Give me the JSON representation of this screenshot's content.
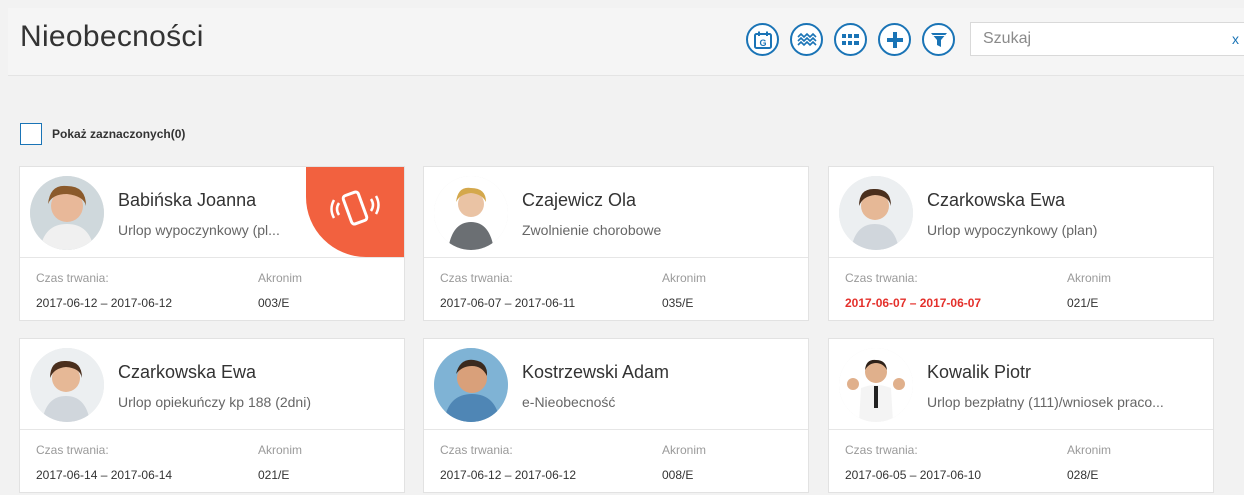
{
  "header": {
    "title": "Nieobecności",
    "search_placeholder": "Szukaj",
    "clear_label": "x"
  },
  "toolbar": {
    "icons": [
      "calendar-icon",
      "wave-chart-icon",
      "list-view-icon",
      "add-icon",
      "filter-icon"
    ],
    "accent_color": "#1a74b6",
    "calendar_badge": "G"
  },
  "filter": {
    "show_selected_label": "Pokaż zaznaczonych(0)"
  },
  "labels": {
    "duration": "Czas trwania:",
    "acronym": "Akronim"
  },
  "cards": [
    {
      "name": "Babińska Joanna",
      "reason": "Urlop wypoczynkowy (pl...",
      "dates": "2017-06-12 – 2017-06-12",
      "acronym": "003/E",
      "highlight": false,
      "badge": "phone-icon"
    },
    {
      "name": "Czajewicz Ola",
      "reason": "Zwolnienie chorobowe",
      "dates": "2017-06-07 – 2017-06-11",
      "acronym": "035/E",
      "highlight": false
    },
    {
      "name": "Czarkowska Ewa",
      "reason": "Urlop wypoczynkowy (plan)",
      "dates": "2017-06-07 – 2017-06-07",
      "acronym": "021/E",
      "highlight": true
    },
    {
      "name": "Czarkowska Ewa",
      "reason": "Urlop opiekuńczy kp 188 (2dni)",
      "dates": "2017-06-14 – 2017-06-14",
      "acronym": "021/E",
      "highlight": false
    },
    {
      "name": "Kostrzewski Adam",
      "reason": "e-Nieobecność",
      "dates": "2017-06-12 – 2017-06-12",
      "acronym": "008/E",
      "highlight": false
    },
    {
      "name": "Kowalik Piotr",
      "reason": "Urlop bezpłatny (111)/wniosek praco...",
      "dates": "2017-06-05 – 2017-06-10",
      "acronym": "028/E",
      "highlight": false
    }
  ],
  "colors": {
    "badge": "#f2613f",
    "highlight_date": "#e4302b"
  }
}
